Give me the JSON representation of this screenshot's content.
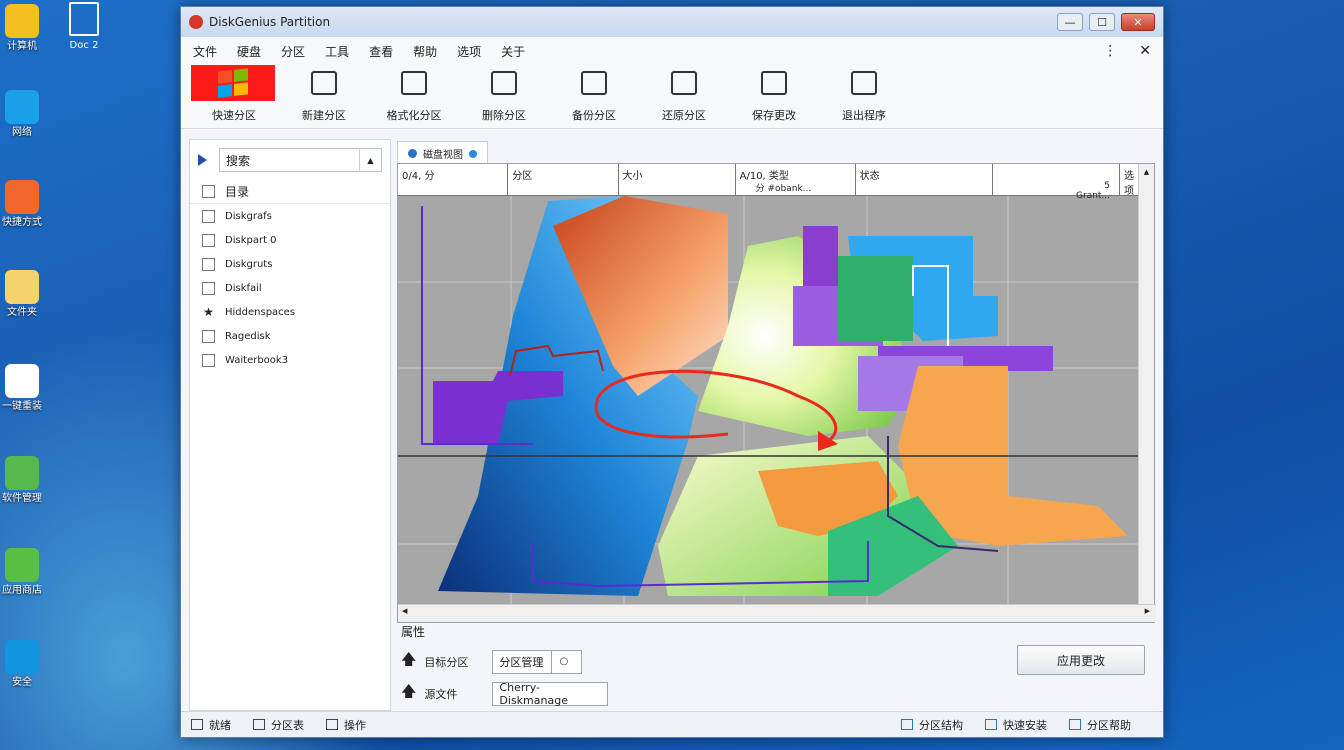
{
  "desktop": {
    "icons": [
      {
        "label": "计算机",
        "color": "#f4c020"
      },
      {
        "label": "网络",
        "color": "#1aa0e8"
      },
      {
        "label": "快捷方式",
        "color": "#f2672c"
      },
      {
        "label": "文件夹",
        "color": "#f4d46a"
      },
      {
        "label": "一键重装",
        "color": "#ffffff"
      },
      {
        "label": "软件管理",
        "color": "#55b94d"
      },
      {
        "label": "应用商店",
        "color": "#57c043"
      },
      {
        "label": "安全",
        "color": "#1296e0"
      }
    ],
    "secondary_icon": {
      "label_line1": "Doc",
      "label_line2": "2"
    }
  },
  "window": {
    "title": "DiskGenius Partition",
    "controls": {
      "minimize": "—",
      "maximize": "☐",
      "close": "✕"
    }
  },
  "menu": {
    "items": [
      "文件",
      "硬盘",
      "分区",
      "工具",
      "查看",
      "帮助",
      "选项",
      "关于"
    ],
    "more": "⋮",
    "pin": "✕"
  },
  "toolbar": {
    "items": [
      {
        "label": "快速分区",
        "icon": "windows-logo-icon"
      },
      {
        "label": "新建分区",
        "icon": "edit-icon"
      },
      {
        "label": "格式化分区",
        "icon": "heart-disk-icon"
      },
      {
        "label": "删除分区",
        "icon": "image-icon"
      },
      {
        "label": "备份分区",
        "icon": "people-icon"
      },
      {
        "label": "还原分区",
        "icon": "building-icon"
      },
      {
        "label": "保存更改",
        "icon": "print-icon"
      },
      {
        "label": "退出程序",
        "icon": "phone-icon"
      }
    ]
  },
  "sidebar": {
    "search_value": "搜索",
    "header": "目录",
    "items": [
      {
        "label": "Diskgrafs",
        "marker": "checkbox"
      },
      {
        "label": "Diskpart 0",
        "marker": "checkbox"
      },
      {
        "label": "Diskgruts",
        "marker": "checkbox"
      },
      {
        "label": "Diskfail",
        "marker": "checkbox"
      },
      {
        "label": "Hiddenspaces",
        "marker": "star"
      },
      {
        "label": "Ragedisk",
        "marker": "checkbox"
      },
      {
        "label": "Waiterbook3",
        "marker": "checkbox"
      }
    ]
  },
  "main": {
    "tab_label": "磁盘视图",
    "columns": [
      {
        "label": "0/4, 分"
      },
      {
        "label": "分区"
      },
      {
        "label": "大小"
      },
      {
        "label": "A/10, 类型",
        "sub": "分 #obank..."
      },
      {
        "label": "状态"
      },
      {
        "label": ""
      },
      {
        "label": "选项",
        "sub": "5 Grant..."
      }
    ],
    "colors": {
      "blue": "#2a9be0",
      "orange": "#f29a3a",
      "green": "#72c94a",
      "purple": "#8a4fd6",
      "red": "#e8291c"
    }
  },
  "props": {
    "section_label": "属性",
    "rows": [
      {
        "label": "目标分区",
        "value": "分区管理"
      },
      {
        "label": "源文件",
        "value": "Cherry-Diskmanage"
      }
    ],
    "apply_label": "应用更改"
  },
  "statusbar": {
    "left": [
      "就绪",
      "分区表",
      "操作"
    ],
    "right": [
      "分区结构",
      "快速安装",
      "分区帮助"
    ]
  }
}
